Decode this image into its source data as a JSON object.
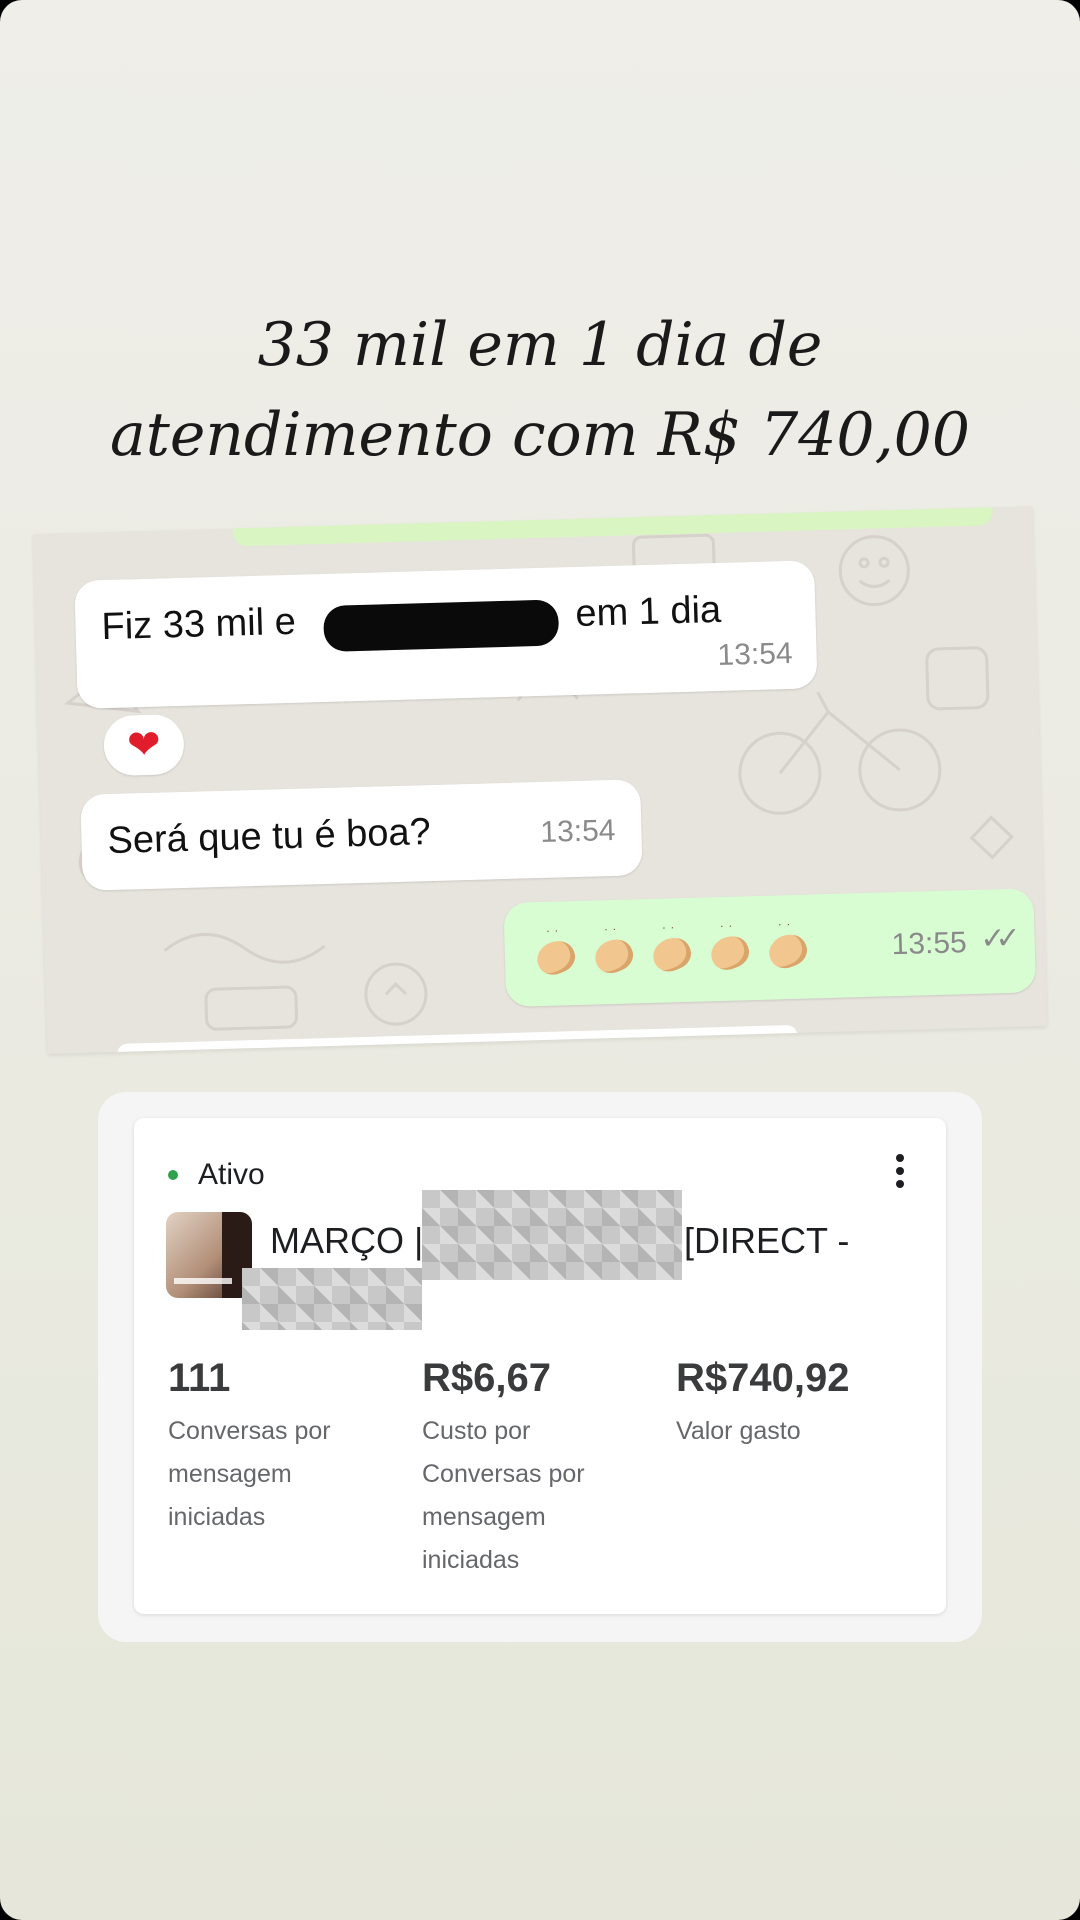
{
  "headline": {
    "line1": "33 mil em 1 dia de",
    "line2": "atendimento com R$ 740,00"
  },
  "chat": {
    "messages": [
      {
        "type": "received",
        "text_before": "Fiz 33 mil e",
        "text_after": "em 1 dia",
        "time": "13:54"
      },
      {
        "type": "reaction",
        "emoji": "❤"
      },
      {
        "type": "received",
        "text": "Será que tu é boa?",
        "time": "13:54"
      },
      {
        "type": "sent",
        "emoji_count": 5,
        "emoji_name": "clapping-hands",
        "time": "13:55",
        "status": "read",
        "ticks": "✓✓"
      }
    ],
    "colors": {
      "background": "#e7e3dd",
      "received_bubble": "#ffffff",
      "sent_bubble": "#d9fdd3"
    }
  },
  "ad_card": {
    "status": "Ativo",
    "status_color": "#31a24c",
    "campaign_name_start": "MARÇO |",
    "campaign_name_end": "[DIRECT -",
    "metrics": [
      {
        "value": "111",
        "label": "Conversas por mensagem iniciadas"
      },
      {
        "value": "R$6,67",
        "label": "Custo por Conversas por mensagem iniciadas"
      },
      {
        "value": "R$740,92",
        "label": "Valor gasto"
      }
    ]
  }
}
